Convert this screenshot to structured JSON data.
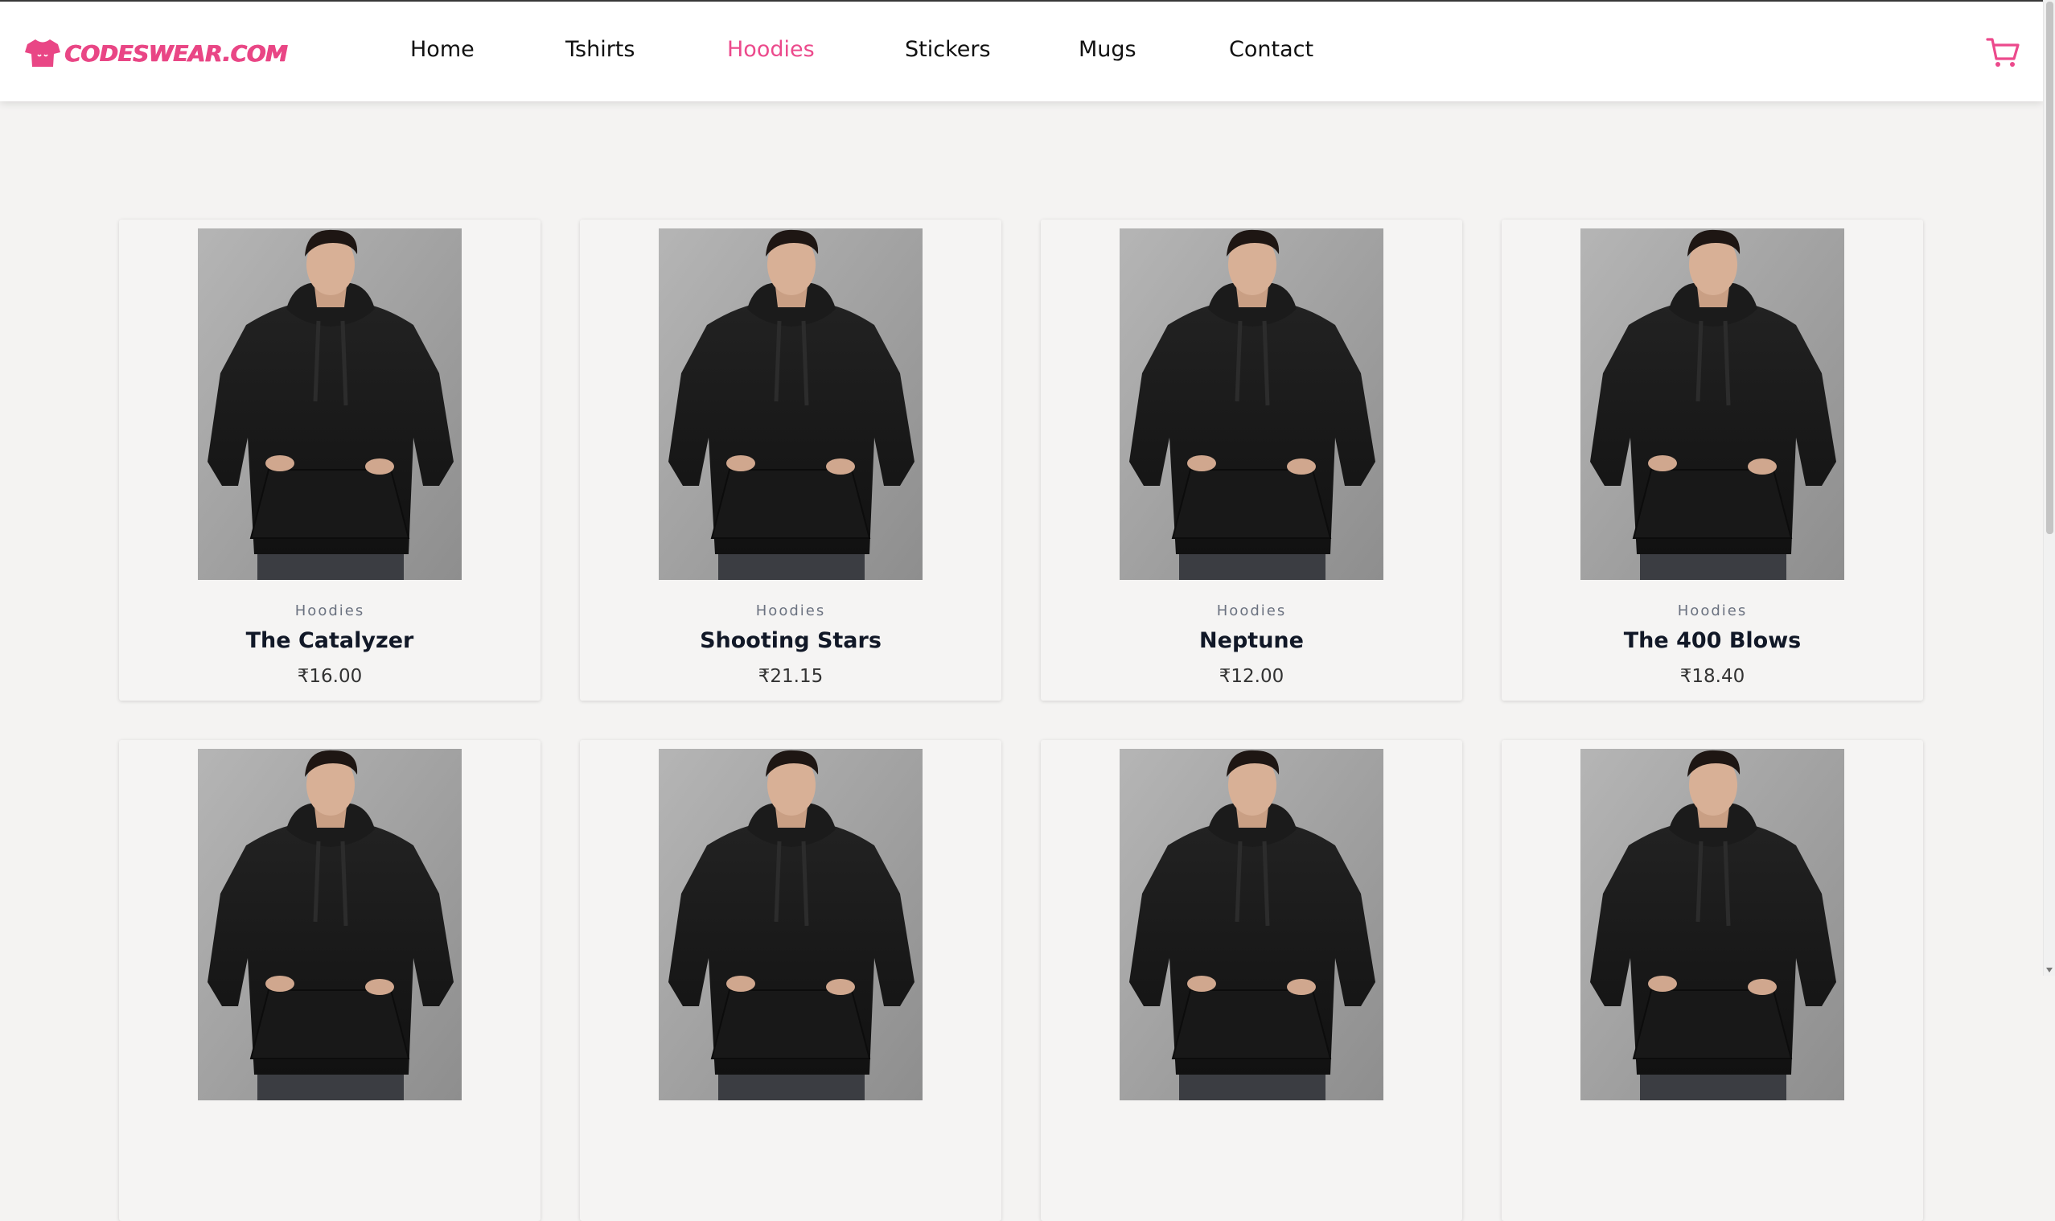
{
  "brand": {
    "name": "CODESWEAR.COM",
    "accent": "#ec4a8c"
  },
  "nav": {
    "items": [
      {
        "label": "Home",
        "active": false
      },
      {
        "label": "Tshirts",
        "active": false
      },
      {
        "label": "Hoodies",
        "active": true
      },
      {
        "label": "Stickers",
        "active": false
      },
      {
        "label": "Mugs",
        "active": false
      },
      {
        "label": "Contact",
        "active": false
      }
    ],
    "cart_icon": "shopping-cart-icon"
  },
  "products": [
    {
      "category": "Hoodies",
      "name": "The Catalyzer",
      "price": "₹16.00"
    },
    {
      "category": "Hoodies",
      "name": "Shooting Stars",
      "price": "₹21.15"
    },
    {
      "category": "Hoodies",
      "name": "Neptune",
      "price": "₹12.00"
    },
    {
      "category": "Hoodies",
      "name": "The 400 Blows",
      "price": "₹18.40"
    },
    {
      "category": "",
      "name": "",
      "price": ""
    },
    {
      "category": "",
      "name": "",
      "price": ""
    },
    {
      "category": "",
      "name": "",
      "price": ""
    },
    {
      "category": "",
      "name": "",
      "price": ""
    }
  ]
}
